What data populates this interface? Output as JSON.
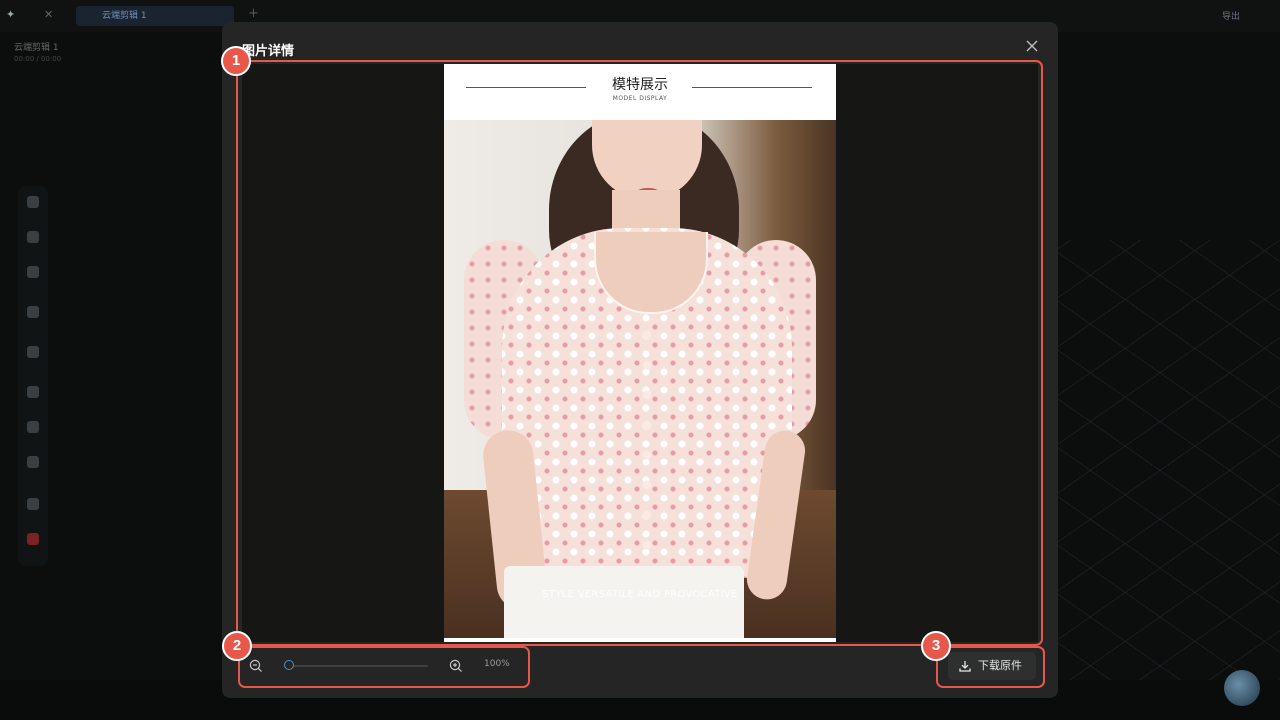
{
  "background_app": {
    "tab_label": "云端剪辑 1",
    "right_label": "导出",
    "project_name": "云端剪辑 1",
    "project_meta": "00:00 / 00:00"
  },
  "modal": {
    "title": "图片详情",
    "close_icon": "close-icon"
  },
  "image": {
    "header_title": "模特展示",
    "header_subtitle": "MODEL DISPLAY",
    "caption": "STYLE VERSATILE AND PROVOCATIVE"
  },
  "zoom": {
    "zoom_out_icon": "zoom-out-icon",
    "zoom_in_icon": "zoom-in-icon",
    "value_label": "100%",
    "slider_fraction": 0.0
  },
  "download": {
    "label": "下载原件",
    "icon": "download-icon"
  },
  "annotations": {
    "badge_1": "1",
    "badge_2": "2",
    "badge_3": "3"
  },
  "colors": {
    "highlight": "#e8584a",
    "modal_bg": "#242524",
    "viewer_bg": "#161614",
    "slider_accent": "#4a90c8"
  }
}
